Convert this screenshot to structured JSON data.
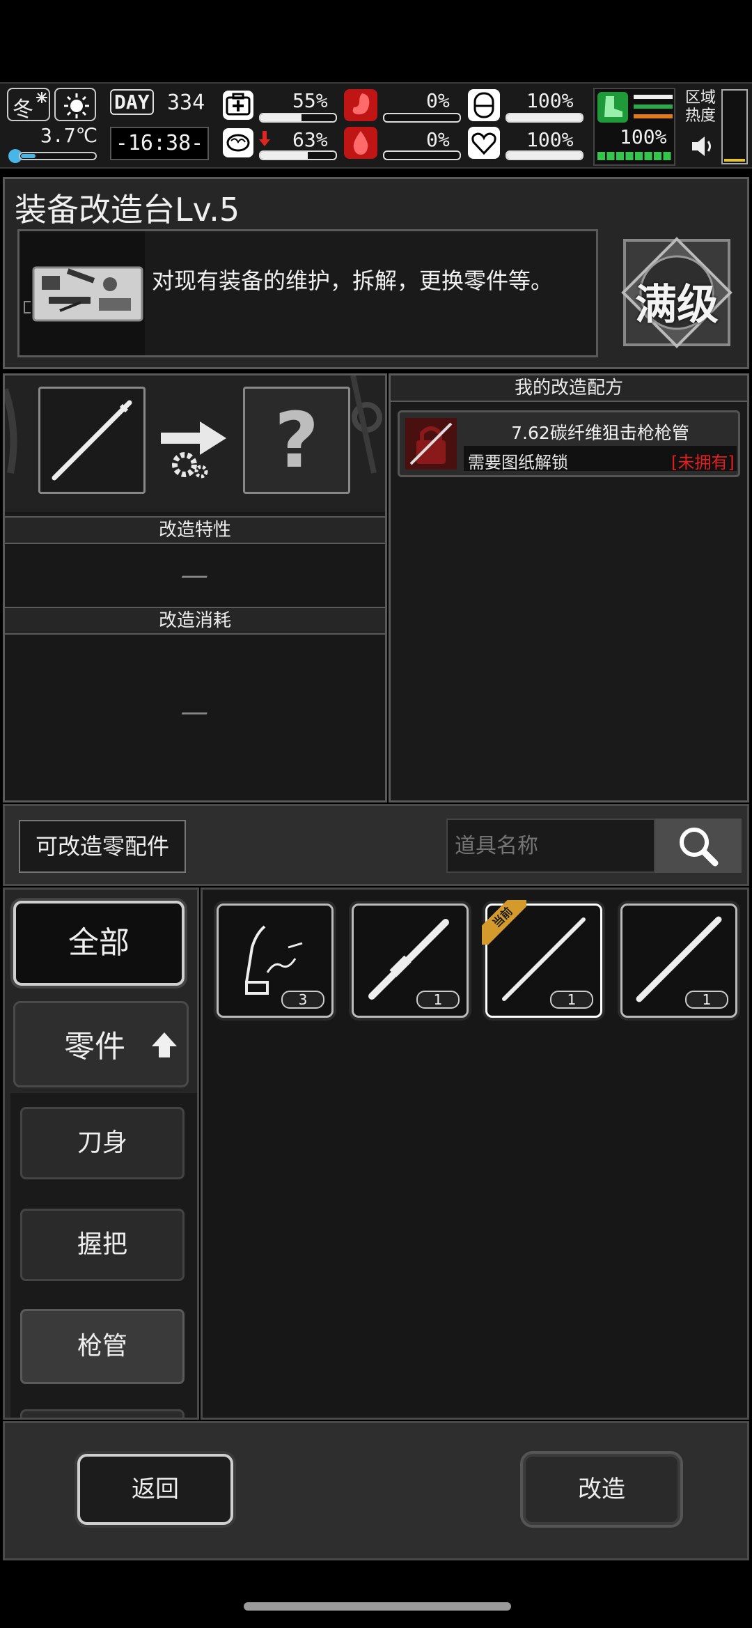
{
  "status_bar": {
    "season": "冬",
    "temperature": "3.7℃",
    "temperature_level": 0.2,
    "day_label": "DAY",
    "day": "334",
    "clock": "-16:38-",
    "health_pct": "55%",
    "health_level": 0.55,
    "sanity_pct": "63%",
    "sanity_level": 0.63,
    "hunger_pct": "0%",
    "hunger_level": 0,
    "thirst_pct": "0%",
    "thirst_level": 0,
    "protection_pct": "100%",
    "protection_level": 1,
    "mood_pct": "100%",
    "mood_level": 1,
    "stamina_pct": "100%",
    "stamina_level": 1,
    "zone_label_1": "区域",
    "zone_label_2": "热度"
  },
  "header": {
    "title": "装备改造台Lv.5",
    "description": "对现有装备的维护，拆解，更换零件等。",
    "badge": "满级"
  },
  "modify": {
    "unknown_symbol": "?",
    "traits_label": "改造特性",
    "traits_value": "—",
    "cost_label": "改造消耗",
    "cost_value": "—"
  },
  "recipes": {
    "title": "我的改造配方",
    "items": [
      {
        "name": "7.62碳纤维狙击枪枪管",
        "requirement": "需要图纸解锁",
        "status": "[未拥有]"
      }
    ]
  },
  "filter": {
    "label": "可改造零配件",
    "search_placeholder": "道具名称"
  },
  "categories": {
    "all": "全部",
    "parts": "零件",
    "sub": [
      "刀身",
      "握把",
      "枪管"
    ]
  },
  "inventory": [
    {
      "count": "3",
      "current": false
    },
    {
      "count": "1",
      "current": false
    },
    {
      "count": "1",
      "current": true,
      "current_tag": "当前"
    },
    {
      "count": "1",
      "current": false
    }
  ],
  "buttons": {
    "back": "返回",
    "modify": "改造"
  }
}
